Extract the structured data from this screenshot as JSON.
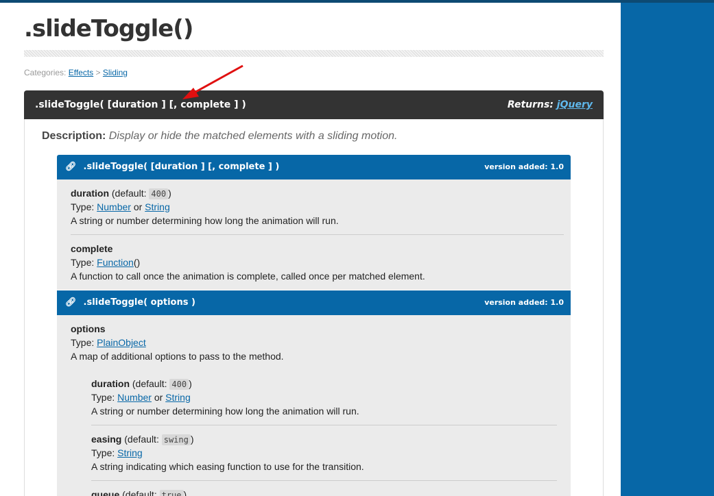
{
  "title": ".slideToggle()",
  "categories": {
    "label": "Categories:",
    "items": [
      "Effects",
      "Sliding"
    ],
    "sep": ">"
  },
  "signature": {
    "text": ".slideToggle( [duration ] [, complete ] )",
    "returns_label": "Returns:",
    "returns_type": "jQuery"
  },
  "description": {
    "label": "Description:",
    "text": "Display or hide the matched elements with a sliding motion."
  },
  "signatures": [
    {
      "title": ".slideToggle( [duration ] [, complete ] )",
      "version": "version added: 1.0",
      "params": [
        {
          "name": "duration",
          "default_label": "(default:",
          "default": "400",
          "type_label": "Type:",
          "types": [
            "Number",
            "String"
          ],
          "or": "or",
          "desc": "A string or number determining how long the animation will run."
        },
        {
          "name": "complete",
          "type_label": "Type:",
          "types": [
            "Function"
          ],
          "suffix": "()",
          "desc": "A function to call once the animation is complete, called once per matched element."
        }
      ]
    },
    {
      "title": ".slideToggle( options )",
      "version": "version added: 1.0",
      "params": [
        {
          "name": "options",
          "type_label": "Type:",
          "types": [
            "PlainObject"
          ],
          "desc": "A map of additional options to pass to the method.",
          "nested": [
            {
              "name": "duration",
              "default": "400",
              "types": [
                "Number",
                "String"
              ],
              "desc": "A string or number determining how long the animation will run."
            },
            {
              "name": "easing",
              "default": "swing",
              "types": [
                "String"
              ],
              "desc": "A string indicating which easing function to use for the transition."
            },
            {
              "name": "queue",
              "default": "true"
            }
          ]
        }
      ]
    }
  ],
  "colors": {
    "accent": "#0767a7",
    "header_dark": "#333333",
    "annotation_arrow": "#e01010"
  }
}
